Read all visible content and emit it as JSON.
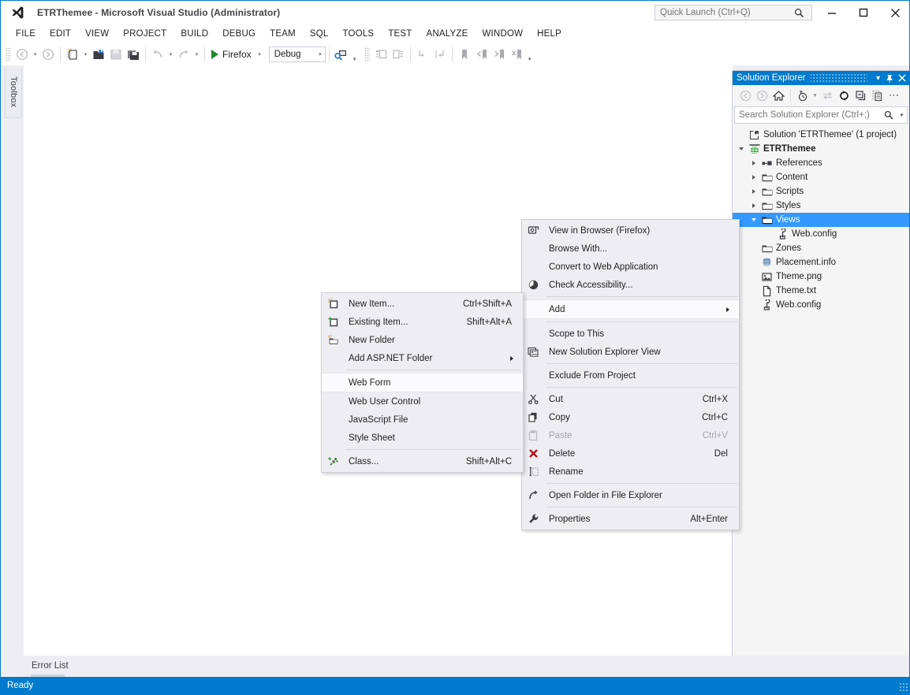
{
  "window": {
    "title": "ETRThemee - Microsoft Visual Studio (Administrator)",
    "logo_icon": "visual-studio-logo-icon",
    "minimize_label": "–",
    "maximize_label": "☐",
    "close_label": "✕"
  },
  "quick_launch": {
    "placeholder": "Quick Launch (Ctrl+Q)",
    "value": "",
    "icon": "search-icon"
  },
  "menubar": {
    "items": [
      {
        "label": "FILE"
      },
      {
        "label": "EDIT"
      },
      {
        "label": "VIEW"
      },
      {
        "label": "PROJECT"
      },
      {
        "label": "BUILD"
      },
      {
        "label": "DEBUG"
      },
      {
        "label": "TEAM"
      },
      {
        "label": "SQL"
      },
      {
        "label": "TOOLS"
      },
      {
        "label": "TEST"
      },
      {
        "label": "ANALYZE"
      },
      {
        "label": "WINDOW"
      },
      {
        "label": "HELP"
      }
    ]
  },
  "toolbar": {
    "run_label": "Firefox",
    "config_value": "Debug",
    "config_caret": "▾"
  },
  "toolbox": {
    "tab_label": "Toolbox"
  },
  "solution_explorer": {
    "title": "Solution Explorer",
    "search_placeholder": "Search Solution Explorer (Ctrl+;)",
    "search_value": "",
    "tree": [
      {
        "label": "Solution 'ETRThemee' (1 project)",
        "indent": 0,
        "icon": "solution-icon",
        "twisty": "none",
        "bold": false,
        "selected": false
      },
      {
        "label": "ETRThemee",
        "indent": 1,
        "icon": "web-project-icon",
        "twisty": "open",
        "bold": true,
        "selected": false
      },
      {
        "label": "References",
        "indent": 2,
        "icon": "references-icon",
        "twisty": "closed",
        "bold": false,
        "selected": false
      },
      {
        "label": "Content",
        "indent": 2,
        "icon": "folder-icon",
        "twisty": "closed",
        "bold": false,
        "selected": false
      },
      {
        "label": "Scripts",
        "indent": 2,
        "icon": "folder-icon",
        "twisty": "closed",
        "bold": false,
        "selected": false
      },
      {
        "label": "Styles",
        "indent": 2,
        "icon": "folder-icon",
        "twisty": "closed",
        "bold": false,
        "selected": false
      },
      {
        "label": "Views",
        "indent": 2,
        "icon": "folder-icon",
        "twisty": "open",
        "bold": false,
        "selected": true
      },
      {
        "label": "Web.config",
        "indent": 3,
        "icon": "config-file-icon",
        "twisty": "none",
        "bold": false,
        "selected": false
      },
      {
        "label": "Zones",
        "indent": 2,
        "icon": "folder-icon",
        "twisty": "none",
        "bold": false,
        "selected": false
      },
      {
        "label": "Placement.info",
        "indent": 2,
        "icon": "info-file-icon",
        "twisty": "none",
        "bold": false,
        "selected": false
      },
      {
        "label": "Theme.png",
        "indent": 2,
        "icon": "image-file-icon",
        "twisty": "none",
        "bold": false,
        "selected": false
      },
      {
        "label": "Theme.txt",
        "indent": 2,
        "icon": "text-file-icon",
        "twisty": "none",
        "bold": false,
        "selected": false
      },
      {
        "label": "Web.config",
        "indent": 2,
        "icon": "config-file-icon",
        "twisty": "none",
        "bold": false,
        "selected": false
      }
    ]
  },
  "context_menu": {
    "items": [
      {
        "label": "View in Browser (Firefox)",
        "shortcut": "",
        "icon": "browser-icon",
        "highlighted": false,
        "disabled": false,
        "submenu": false,
        "sep_after": false
      },
      {
        "label": "Browse With...",
        "shortcut": "",
        "icon": "",
        "highlighted": false,
        "disabled": false,
        "submenu": false,
        "sep_after": false
      },
      {
        "label": "Convert to Web Application",
        "shortcut": "",
        "icon": "",
        "highlighted": false,
        "disabled": false,
        "submenu": false,
        "sep_after": false
      },
      {
        "label": "Check Accessibility...",
        "shortcut": "",
        "icon": "accessibility-clock-icon",
        "highlighted": false,
        "disabled": false,
        "submenu": false,
        "sep_after": true
      },
      {
        "label": "Add",
        "shortcut": "",
        "icon": "",
        "highlighted": true,
        "disabled": false,
        "submenu": true,
        "sep_after": true
      },
      {
        "label": "Scope to This",
        "shortcut": "",
        "icon": "",
        "highlighted": false,
        "disabled": false,
        "submenu": false,
        "sep_after": false
      },
      {
        "label": "New Solution Explorer View",
        "shortcut": "",
        "icon": "new-solution-view-icon",
        "highlighted": false,
        "disabled": false,
        "submenu": false,
        "sep_after": true
      },
      {
        "label": "Exclude From Project",
        "shortcut": "",
        "icon": "",
        "highlighted": false,
        "disabled": false,
        "submenu": false,
        "sep_after": true
      },
      {
        "label": "Cut",
        "shortcut": "Ctrl+X",
        "icon": "scissors-icon",
        "highlighted": false,
        "disabled": false,
        "submenu": false,
        "sep_after": false
      },
      {
        "label": "Copy",
        "shortcut": "Ctrl+C",
        "icon": "copy-icon",
        "highlighted": false,
        "disabled": false,
        "submenu": false,
        "sep_after": false
      },
      {
        "label": "Paste",
        "shortcut": "Ctrl+V",
        "icon": "paste-icon",
        "highlighted": false,
        "disabled": true,
        "submenu": false,
        "sep_after": false
      },
      {
        "label": "Delete",
        "shortcut": "Del",
        "icon": "delete-x-icon",
        "highlighted": false,
        "disabled": false,
        "submenu": false,
        "sep_after": false
      },
      {
        "label": "Rename",
        "shortcut": "",
        "icon": "rename-icon",
        "highlighted": false,
        "disabled": false,
        "submenu": false,
        "sep_after": true
      },
      {
        "label": "Open Folder in File Explorer",
        "shortcut": "",
        "icon": "open-folder-arrow-icon",
        "highlighted": false,
        "disabled": false,
        "submenu": false,
        "sep_after": true
      },
      {
        "label": "Properties",
        "shortcut": "Alt+Enter",
        "icon": "wrench-icon",
        "highlighted": false,
        "disabled": false,
        "submenu": false,
        "sep_after": false
      }
    ]
  },
  "add_submenu": {
    "items": [
      {
        "label": "New Item...",
        "shortcut": "Ctrl+Shift+A",
        "icon": "new-item-icon",
        "highlighted": false,
        "submenu": false,
        "sep_after": false
      },
      {
        "label": "Existing Item...",
        "shortcut": "Shift+Alt+A",
        "icon": "existing-item-icon",
        "highlighted": false,
        "submenu": false,
        "sep_after": false
      },
      {
        "label": "New Folder",
        "shortcut": "",
        "icon": "new-folder-icon",
        "highlighted": false,
        "submenu": false,
        "sep_after": false
      },
      {
        "label": "Add ASP.NET Folder",
        "shortcut": "",
        "icon": "",
        "highlighted": false,
        "submenu": true,
        "sep_after": true
      },
      {
        "label": "Web Form",
        "shortcut": "",
        "icon": "",
        "highlighted": true,
        "submenu": false,
        "sep_after": false
      },
      {
        "label": "Web User Control",
        "shortcut": "",
        "icon": "",
        "highlighted": false,
        "submenu": false,
        "sep_after": false
      },
      {
        "label": "JavaScript File",
        "shortcut": "",
        "icon": "",
        "highlighted": false,
        "submenu": false,
        "sep_after": false
      },
      {
        "label": "Style Sheet",
        "shortcut": "",
        "icon": "",
        "highlighted": false,
        "submenu": false,
        "sep_after": true
      },
      {
        "label": "Class...",
        "shortcut": "Shift+Alt+C",
        "icon": "class-icon",
        "highlighted": false,
        "submenu": false,
        "sep_after": false
      }
    ]
  },
  "error_list": {
    "tab_label": "Error List"
  },
  "status_bar": {
    "text": "Ready"
  },
  "colors": {
    "accent": "#007acc",
    "selection": "#3399ff",
    "chrome": "#eeeef2",
    "menu_bg": "#eeeef2"
  }
}
